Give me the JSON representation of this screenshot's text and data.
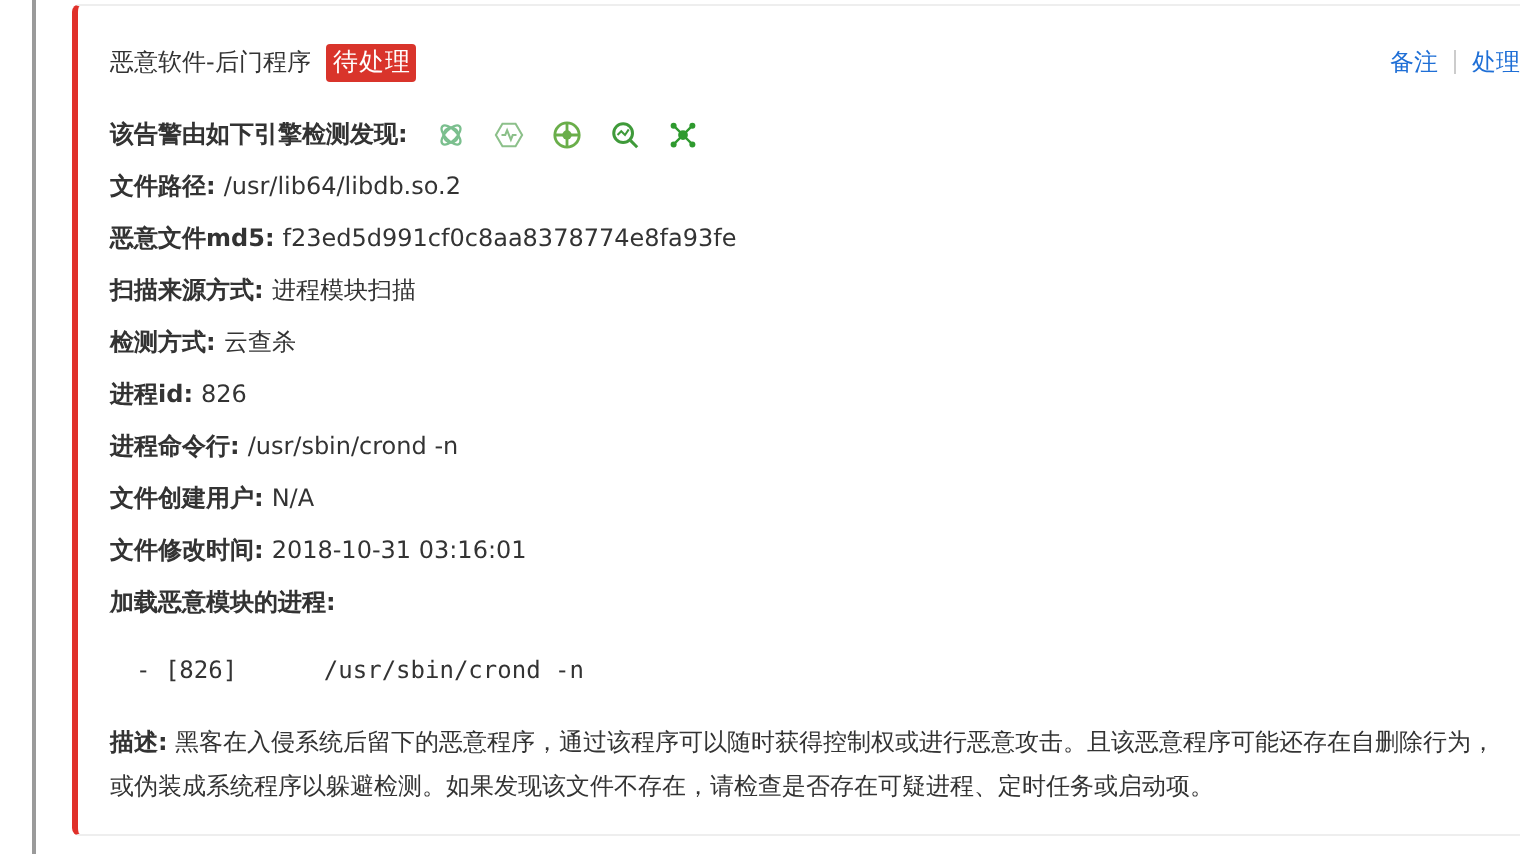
{
  "alert": {
    "title": "恶意软件-后门程序",
    "status": "待处理",
    "actions": [
      {
        "label": "备注"
      },
      {
        "label": "处理"
      }
    ],
    "engines_label": "该告警由如下引擎检测发现:",
    "fields": [
      {
        "label": "文件路径:",
        "value": "/usr/lib64/libdb.so.2"
      },
      {
        "label": "恶意文件md5:",
        "value": "f23ed5d991cf0c8aa8378774e8fa93fe"
      },
      {
        "label": "扫描来源方式:",
        "value": "进程模块扫描"
      },
      {
        "label": "检测方式:",
        "value": "云查杀"
      },
      {
        "label": "进程id:",
        "value": "826"
      },
      {
        "label": "进程命令行:",
        "value": "/usr/sbin/crond -n"
      },
      {
        "label": "文件创建用户:",
        "value": "N/A"
      },
      {
        "label": "文件修改时间:",
        "value": "2018-10-31 03:16:01"
      }
    ],
    "process_label": "加载恶意模块的进程:",
    "process_line": "- [826]      /usr/sbin/crond -n",
    "description": "**描述:** 黑客在入侵系统后留下的恶意程序，通过该程序可以随时获得控制权或进行恶意攻击。且该恶意程序可能还存在自删除行为，或伪装成系统程序以躲避检测。如果发现该文件不存在，请检查是否存在可疑进程、定时任务或启动项。"
  }
}
